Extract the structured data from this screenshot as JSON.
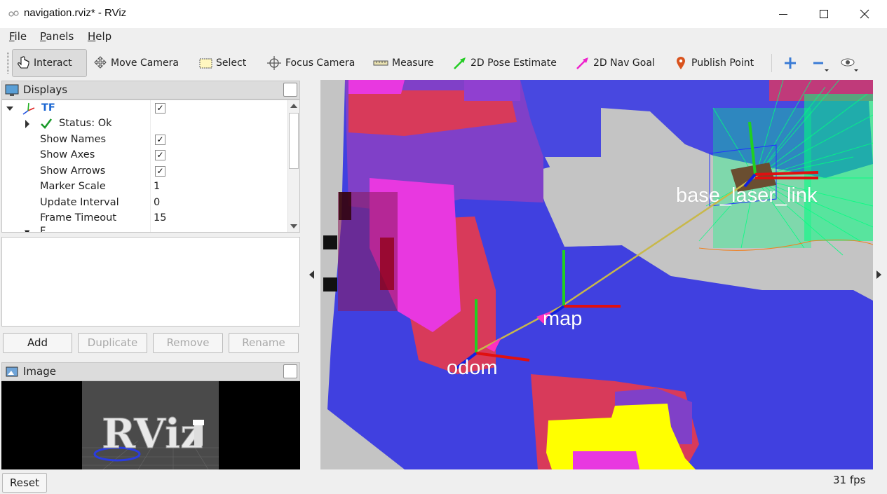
{
  "window": {
    "title": "navigation.rviz* - RViz",
    "controls": {
      "minimize": "—",
      "maximize": "☐",
      "close": "✕"
    }
  },
  "menu": {
    "items": [
      {
        "u": "F",
        "rest": "ile"
      },
      {
        "u": "P",
        "rest": "anels"
      },
      {
        "u": "H",
        "rest": "elp"
      }
    ]
  },
  "toolbar": {
    "tools": [
      {
        "label": "Interact",
        "icon": "hand-pointer-icon",
        "active": true
      },
      {
        "label": "Move Camera",
        "icon": "move-camera-icon"
      },
      {
        "label": "Select",
        "icon": "select-box-icon"
      },
      {
        "label": "Focus Camera",
        "icon": "focus-crosshair-icon"
      },
      {
        "label": "Measure",
        "icon": "ruler-icon"
      },
      {
        "label": "2D Pose Estimate",
        "icon": "green-arrow-icon",
        "color": "#22cc22"
      },
      {
        "label": "2D Nav Goal",
        "icon": "magenta-arrow-icon",
        "color": "#ee22cc"
      },
      {
        "label": "Publish Point",
        "icon": "map-pin-icon",
        "color": "#d9531e"
      }
    ],
    "extra_icons": [
      "plus-icon",
      "minus-icon",
      "eye-icon"
    ]
  },
  "displays": {
    "title": "Displays",
    "tree": {
      "tf_label": "TF",
      "tf_checked": true,
      "status_label": "Status: Ok",
      "props": [
        {
          "name": "Show Names",
          "checked": true
        },
        {
          "name": "Show Axes",
          "checked": true
        },
        {
          "name": "Show Arrows",
          "checked": true
        },
        {
          "name": "Marker Scale",
          "value": "1"
        },
        {
          "name": "Update Interval",
          "value": "0"
        },
        {
          "name": "Frame Timeout",
          "value": "15"
        }
      ],
      "partial_next": "F"
    },
    "buttons": {
      "add": "Add",
      "duplicate": "Duplicate",
      "remove": "Remove",
      "rename": "Rename"
    }
  },
  "image_panel": {
    "title": "Image",
    "logo_text": "RViz"
  },
  "view3d": {
    "frames": {
      "odom": "odom",
      "map": "map",
      "base_laser_link": "base_laser_link"
    },
    "colors": {
      "free_space": "#c4c4c4",
      "cost_blue": "#4040e0",
      "cost_purple": "#7a3ec8",
      "cost_red": "#d83a5a",
      "cost_magenta": "#e838e0",
      "lethal_yellow": "#ffff00",
      "laser_green": "#00ff80"
    }
  },
  "statusbar": {
    "reset": "Reset",
    "fps": "31 fps"
  }
}
